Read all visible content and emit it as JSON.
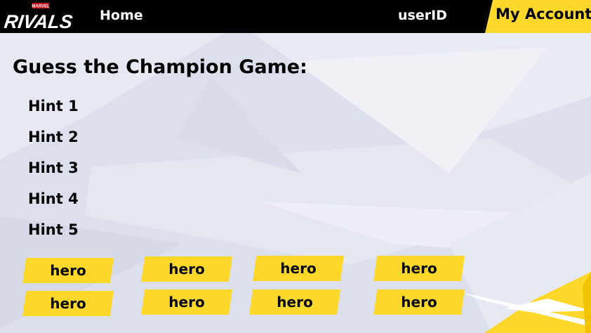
{
  "brand": {
    "logo_top": "MARVEL",
    "logo_main": "RIVALS"
  },
  "nav": {
    "home_label": "Home",
    "user_label": "userID",
    "account_label": "My Account"
  },
  "game": {
    "title": "Guess the Champion Game:",
    "hints": [
      "Hint 1",
      "Hint 2",
      "Hint 3",
      "Hint 4",
      "Hint 5"
    ]
  },
  "heroes": [
    "hero",
    "hero",
    "hero",
    "hero",
    "hero",
    "hero",
    "hero",
    "hero"
  ],
  "colors": {
    "accent": "#fdd82a",
    "topbar": "#000000",
    "background": "#dfe2ee"
  }
}
